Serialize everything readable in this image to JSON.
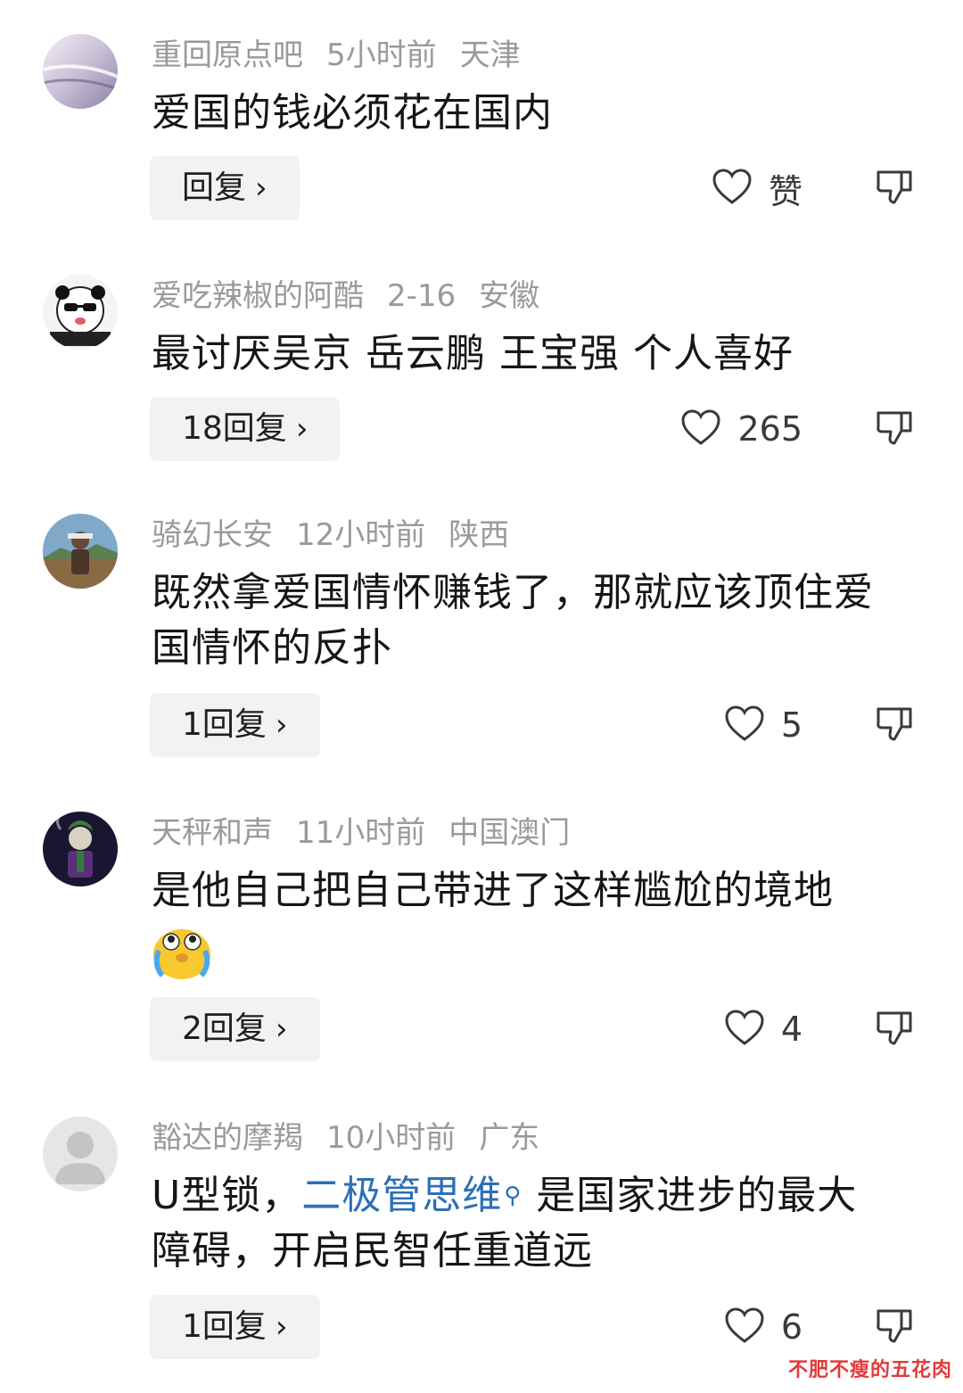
{
  "comments": [
    {
      "username": "重回原点吧",
      "time": "5小时前",
      "location": "天津",
      "text_lines": [
        "爱国的钱必须花在国内"
      ],
      "reply_label": "回复",
      "like_label": "赞"
    },
    {
      "username": "爱吃辣椒的阿酷",
      "time": "2-16",
      "location": "安徽",
      "text_lines": [
        "最讨厌吴京 岳云鹏 王宝强 个人喜好"
      ],
      "reply_label": "18回复",
      "like_label": "265"
    },
    {
      "username": "骑幻长安",
      "time": "12小时前",
      "location": "陕西",
      "text_lines": [
        "既然拿爱国情怀赚钱了，那就应该顶住爱",
        "国情怀的反扑"
      ],
      "reply_label": "1回复",
      "like_label": "5"
    },
    {
      "username": "天秤和声",
      "time": "11小时前",
      "location": "中国澳门",
      "text_lines": [
        "是他自己把自己带进了这样尴尬的境地"
      ],
      "reply_label": "2回复",
      "like_label": "4"
    },
    {
      "username": "豁达的摩羯",
      "time": "10小时前",
      "location": "广东",
      "text_prefix": "U型锁，",
      "text_link": "二极管思维",
      "text_suffix": "是国家进步的最大",
      "text_line2": "障碍，开启民智任重道远",
      "reply_label": "1回复",
      "like_label": "6"
    }
  ],
  "icons": {
    "reply_chevron": "chevron-right-icon",
    "like": "heart-outline-icon",
    "dislike": "thumbs-down-outline-icon",
    "search_link": "search-icon",
    "emoji": "crying-emoji"
  },
  "colors": {
    "meta": "#9a9a9a",
    "link": "#2d6fb8",
    "button_bg": "#f2f2f2",
    "watermark": "#e23b3b"
  },
  "watermark": "不肥不瘦的五花肉"
}
